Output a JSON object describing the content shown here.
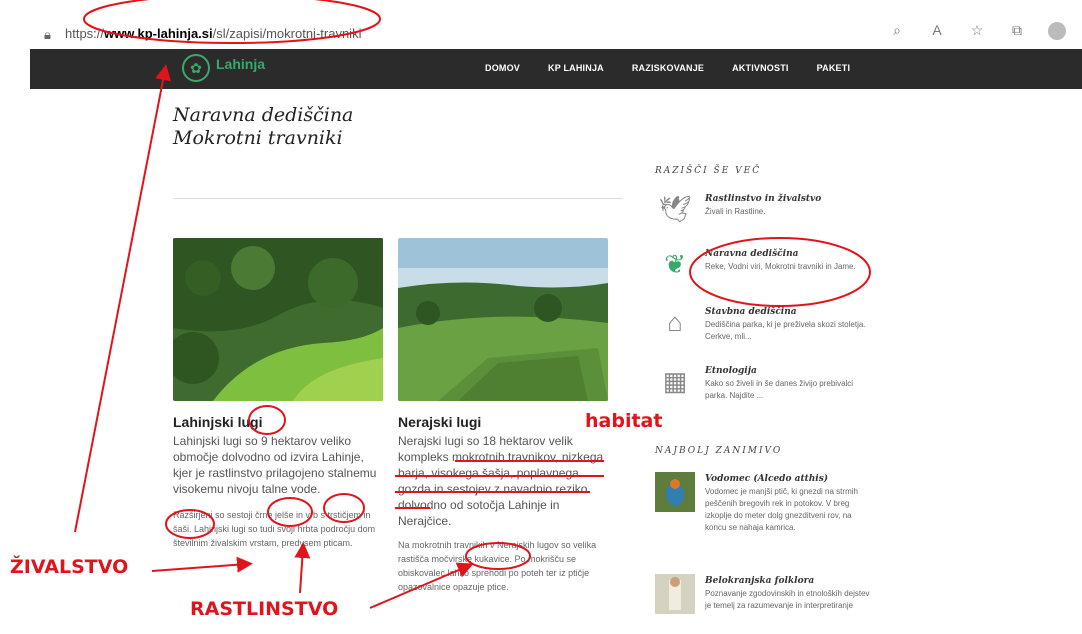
{
  "browser": {
    "url_prefix": "https://",
    "url_host": "www.kp-lahinja.si",
    "url_path": "/sl/zapisi/mokrotni-travniki"
  },
  "nav": {
    "logo_text": "Lahinja",
    "menu": [
      "DOMOV",
      "KP LAHINJA",
      "RAZISKOVANJE",
      "AKTIVNOSTI",
      "PAKETI"
    ]
  },
  "page": {
    "title_line1": "Naravna dediščina",
    "title_line2": "Mokrotni travniki"
  },
  "cards": [
    {
      "title": "Lahinjski lugi",
      "lead": "Lahinjski lugi so 9 hektarov veliko območje dolvodno od izvira Lahinje, kjer je rastlinstvo prilagojeno stalnemu visokemu nivoju talne vode.",
      "small": "Razširjeni so sestoji črne jelše in vrb s trstičjem in šaši. Lahinjski lugi so tudi svoji hrbta področju dom številnim živalskim vrstam, predvsem pticam."
    },
    {
      "title": "Nerajski lugi",
      "lead": "Nerajski lugi so 18 hektarov velik kompleks mokrotnih travnikov, nizkega barja, visokega šašja, poplavnega gozda in sestojev z navadnio reziko dolvodno od sotočja Lahinje in Nerajčice.",
      "small": "Na mokrotnih travnikih v Nerajskih lugov so velika rastišča močvirske kukavice. Po mokrišču se obiskovalec lahko sprehodi po poteh ter iz ptičje opazovalnice opazuje ptice."
    }
  ],
  "sidebar": {
    "heading1": "RAZIŠČI ŠE VEČ",
    "explore": [
      {
        "title": "Rastlinstvo in živalstvo",
        "desc": "Živali in Rastline.",
        "icon": "bird-icon"
      },
      {
        "title": "Naravna dediščina",
        "desc": "Reke, Vodni viri, Mokrotni travniki in Jame.",
        "icon": "leaf-icon"
      },
      {
        "title": "Stavbna dediščina",
        "desc": "Dediščina parka, ki je preživela skozi stoletja. Cerkve, mli...",
        "icon": "hands-icon"
      },
      {
        "title": "Etnologija",
        "desc": "Kako so živeli in še danes živijo prebivalci parka. Najdite ...",
        "icon": "basket-icon"
      }
    ],
    "heading2": "NAJBOLJ ZANIMIVO",
    "featured": [
      {
        "title": "Vodomec (Alcedo atthis)",
        "desc": "Vodomec je manjši ptič, ki gnezdi na strmih peščenih bregovih rek in potokov. V breg izkoplje do meter dolg gnezditveni rov, na koncu se nahaja kamrica."
      },
      {
        "title": "Belokranjska folklora",
        "desc": "Poznavanje zgodovinskih in etnoloških dejstev je temelj za razumevanje in interpretiranje"
      }
    ]
  },
  "annotations": {
    "habitat": "habitat",
    "zivalstvo": "ŽIVALSTVO",
    "rastlinstvo": "RASTLINSTVO",
    "color": "#e0141b"
  }
}
